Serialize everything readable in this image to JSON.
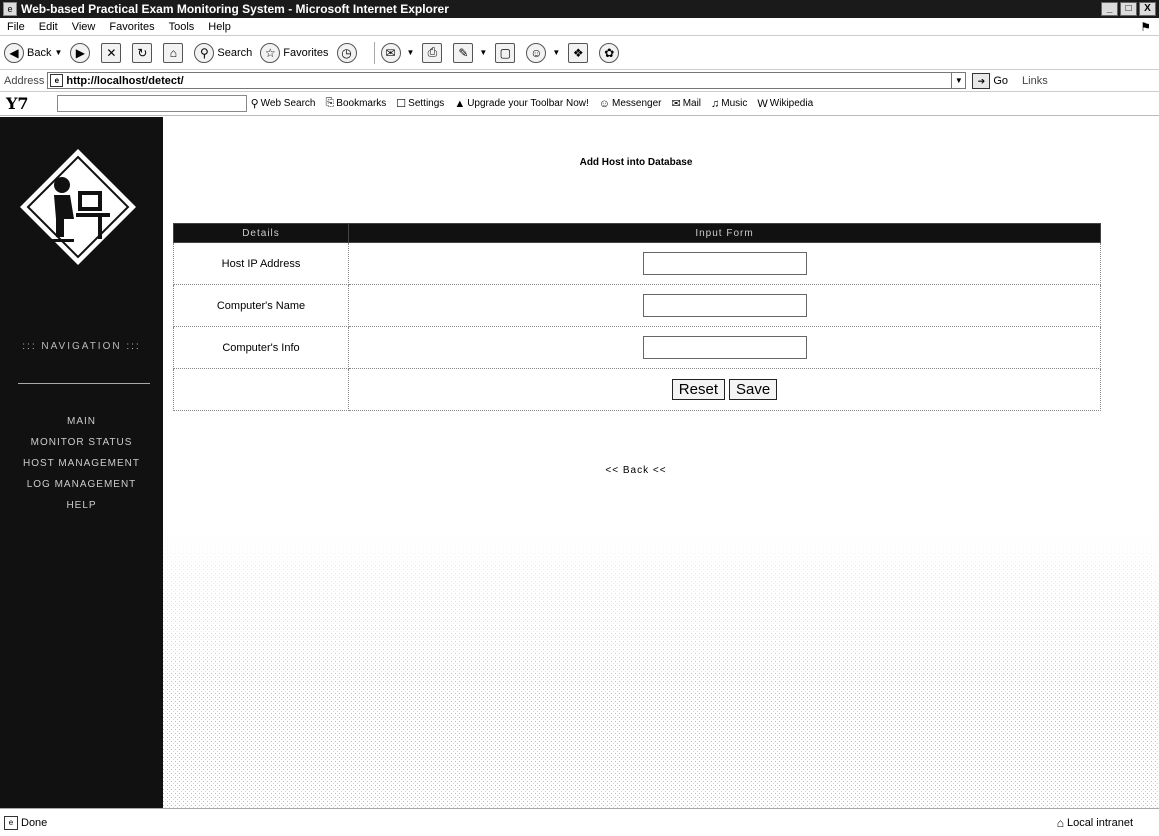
{
  "window": {
    "title": "Web-based Practical Exam Monitoring System - Microsoft Internet Explorer",
    "minimize": "_",
    "maximize": "□",
    "close": "X"
  },
  "menu": [
    "File",
    "Edit",
    "View",
    "Favorites",
    "Tools",
    "Help"
  ],
  "toolbar": {
    "back": "Back",
    "search": "Search",
    "favorites": "Favorites"
  },
  "address": {
    "label": "Address",
    "url": "http://localhost/detect/",
    "go": "Go",
    "links": "Links"
  },
  "yahoo": {
    "logo": "Y7",
    "items": [
      "Web Search",
      "Bookmarks",
      "Settings",
      "Upgrade your Toolbar Now!",
      "Messenger",
      "Mail",
      "Music",
      "Wikipedia"
    ]
  },
  "sidebar": {
    "nav_title": "::: NAVIGATION :::",
    "items": [
      "MAIN",
      "MONITOR STATUS",
      "HOST MANAGEMENT",
      "LOG MANAGEMENT",
      "HELP"
    ]
  },
  "form": {
    "title": "Add Host into Database",
    "headers": [
      "Details",
      "Input Form"
    ],
    "fields": [
      {
        "label": "Host IP Address",
        "value": ""
      },
      {
        "label": "Computer's Name",
        "value": ""
      },
      {
        "label": "Computer's Info",
        "value": ""
      }
    ],
    "reset": "Reset",
    "save": "Save",
    "back": "<< Back <<"
  },
  "status": {
    "text": "Done",
    "zone": "Local intranet"
  }
}
